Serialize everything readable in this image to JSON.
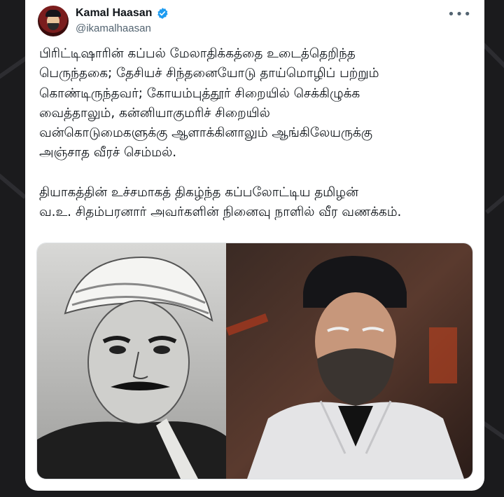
{
  "tweet": {
    "author_name": "Kamal Haasan",
    "handle": "@ikamalhaasan",
    "more_icon": "•••",
    "body_lines": [
      "பிரிட்டிஷாரின் கப்பல் மேலாதிக்கத்தை உடைத்தெறிந்த",
      "பெருந்தகை; தேசியச் சிந்தனையோடு தாய்மொழிப் பற்றும்",
      "கொண்டிருந்தவர்; கோயம்புத்தூர் சிறையில் செக்கிழுக்க",
      "வைத்தாலும், கன்னியாகுமரிச் சிறையில்",
      "வன்கொடுமைகளுக்கு ஆளாக்கினாலும் ஆங்கிலேயருக்கு",
      "அஞ்சாத வீரச் செம்மல்."
    ],
    "body_lines_2": [
      "தியாகத்தின் உச்சமாகத் திகழ்ந்த கப்பலோட்டிய தமிழன்",
      "வ.உ. சிதம்பரனார் அவர்களின் நினைவு நாளில் வீர வணக்கம்."
    ]
  },
  "icons": {
    "verified": "verified-badge-icon",
    "more": "more-options-icon"
  },
  "colors": {
    "name": "#0f1419",
    "handle": "#536471",
    "verified": "#1d9bf0",
    "background": "#1b1b1d"
  }
}
